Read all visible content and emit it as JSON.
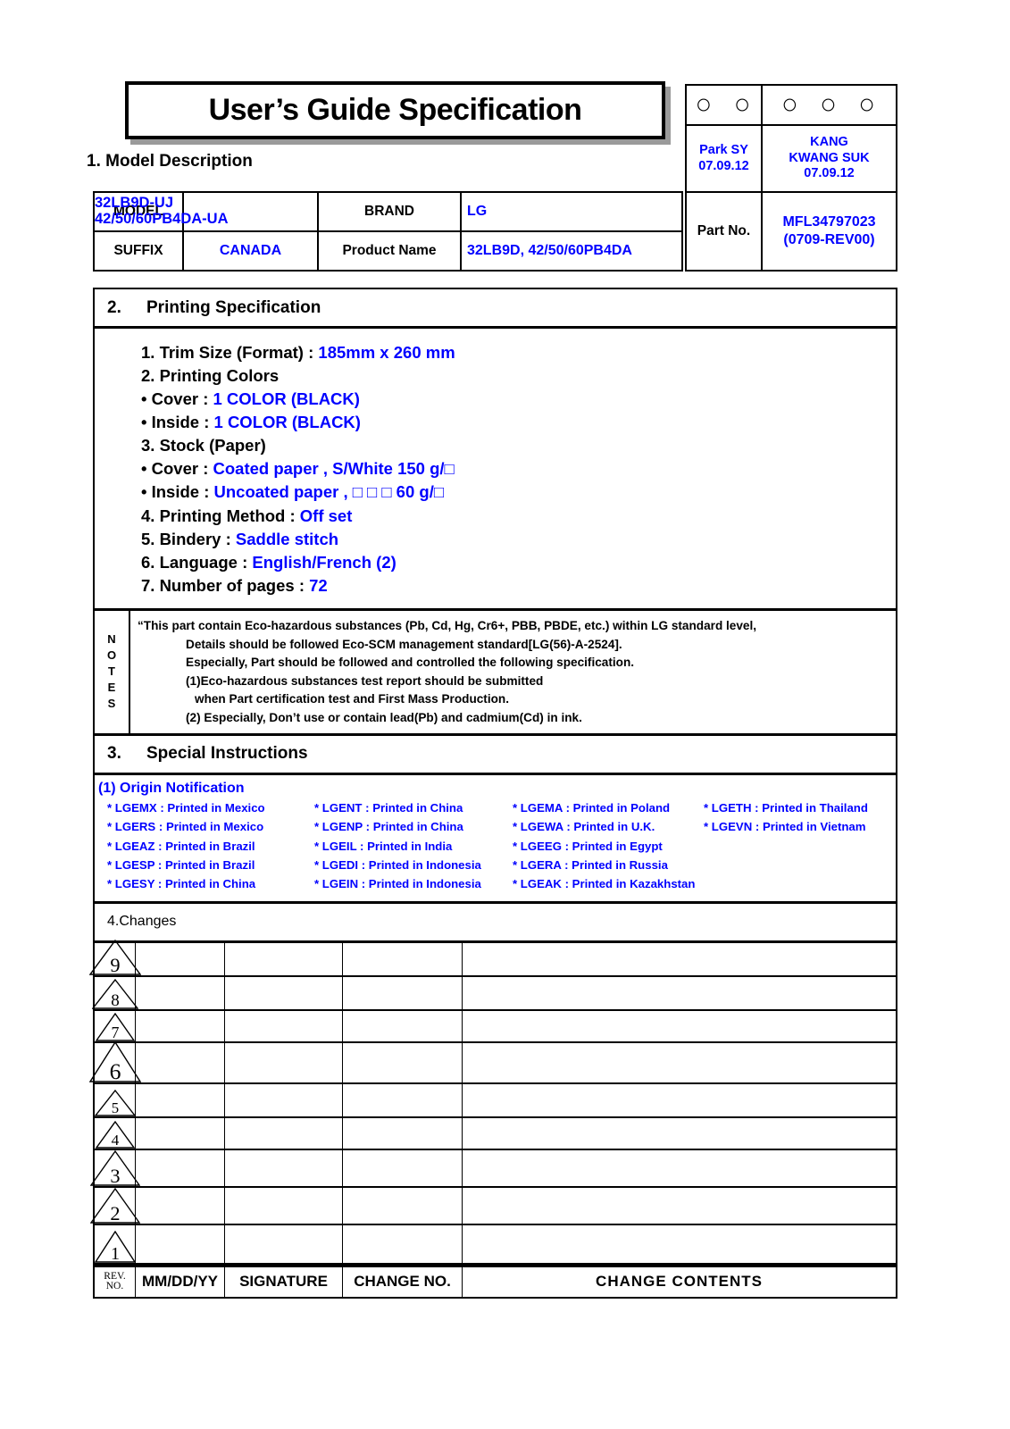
{
  "title": "User’s Guide Specification",
  "approval": {
    "header_cells": [
      "〇 〇",
      "〇 〇 〇"
    ],
    "approver1": "Park SY\n07.09.12",
    "approver2": "KANG\nKWANG SUK\n07.09.12"
  },
  "model_section": {
    "heading_number": "1.",
    "heading_text": "Model Description",
    "model_label": "MODEL",
    "model_value": "32LB9D-UJ\n42/50/60PB4DA-UA",
    "brand_label": "BRAND",
    "brand_value": "LG",
    "suffix_label": "SUFFIX",
    "suffix_value": "CANADA",
    "product_name_label": "Product Name",
    "product_name_value": "32LB9D, 42/50/60PB4DA",
    "part_no_label": "Part No.",
    "part_no_value": "MFL34797023\n(0709-REV00)"
  },
  "printing_section": {
    "heading_number": "2.",
    "heading_text": "Printing Specification",
    "lines": [
      {
        "label": "1. Trim Size (Format) : ",
        "value": "185mm x 260 mm"
      },
      {
        "label": "2. Printing Colors",
        "value": ""
      },
      {
        "label": "• Cover : ",
        "value": "1 COLOR (BLACK)"
      },
      {
        "label": "• Inside : ",
        "value": "1 COLOR (BLACK)"
      },
      {
        "label": "3. Stock (Paper)",
        "value": ""
      },
      {
        "label": "• Cover : ",
        "value": "Coated paper , S/White 150 g/□"
      },
      {
        "label": "• Inside : ",
        "value": "Uncoated paper , □ □ □  60 g/□"
      },
      {
        "label": "4. Printing Method : ",
        "value": "Off set"
      },
      {
        "label": "5. Bindery  : ",
        "value": "Saddle stitch"
      },
      {
        "label": "6. Language : ",
        "value": "English/French (2)"
      },
      {
        "label": "7. Number of pages : ",
        "value": "72"
      }
    ]
  },
  "notes": {
    "label_letters": [
      "N",
      "O",
      "T",
      "E",
      "S"
    ],
    "lines": [
      {
        "indent": 1,
        "text": "“This part contain Eco-hazardous substances (Pb, Cd, Hg, Cr6+, PBB, PBDE, etc.) within LG standard level,"
      },
      {
        "indent": 2,
        "text": "Details should be followed Eco-SCM management standard[LG(56)-A-2524]."
      },
      {
        "indent": 2,
        "text": "Especially, Part should be followed and controlled the following specification."
      },
      {
        "indent": 2,
        "text": "(1)Eco-hazardous substances test report should be submitted"
      },
      {
        "indent": 3,
        "text": "when  Part certification test and First Mass Production."
      },
      {
        "indent": 2,
        "text": "(2) Especially, Don’t use or contain lead(Pb) and cadmium(Cd) in ink."
      }
    ]
  },
  "special_section": {
    "heading_number": "3.",
    "heading_text": "Special Instructions",
    "origin_title": "(1) Origin Notification",
    "origin_entries": [
      "* LGEMX : Printed in Mexico",
      "* LGENT : Printed in China",
      "* LGEMA : Printed in Poland",
      "* LGETH : Printed in Thailand",
      "* LGERS : Printed in Mexico",
      "* LGENP : Printed in China",
      "* LGEWA : Printed in U.K.",
      "* LGEVN : Printed in Vietnam",
      "* LGEAZ : Printed in Brazil",
      "* LGEIL : Printed in India",
      "* LGEEG : Printed in Egypt",
      "",
      "* LGESP : Printed in Brazil",
      "* LGEDI : Printed in Indonesia",
      "* LGERA : Printed in Russia",
      "",
      "* LGESY : Printed in China",
      "* LGEIN : Printed in Indonesia",
      "* LGEAK : Printed in Kazakhstan",
      ""
    ]
  },
  "changes_section": {
    "heading_number": "4.",
    "heading_text": "Changes",
    "rows": [
      {
        "rev": "9",
        "date": "",
        "signature": "",
        "change_no": "",
        "contents": "",
        "tri_w": 58,
        "tri_h": 40
      },
      {
        "rev": "8",
        "date": "",
        "signature": "",
        "change_no": "",
        "contents": "",
        "tri_w": 52,
        "tri_h": 34
      },
      {
        "rev": "7",
        "date": "",
        "signature": "",
        "change_no": "",
        "contents": "",
        "tri_w": 44,
        "tri_h": 32
      },
      {
        "rev": "6",
        "date": "",
        "signature": "",
        "change_no": "",
        "contents": "",
        "tri_w": 58,
        "tri_h": 46
      },
      {
        "rev": "5",
        "date": "",
        "signature": "",
        "change_no": "",
        "contents": "",
        "tri_w": 46,
        "tri_h": 30
      },
      {
        "rev": "4",
        "date": "",
        "signature": "",
        "change_no": "",
        "contents": "",
        "tri_w": 44,
        "tri_h": 31
      },
      {
        "rev": "3",
        "date": "",
        "signature": "",
        "change_no": "",
        "contents": "",
        "tri_w": 56,
        "tri_h": 40
      },
      {
        "rev": "2",
        "date": "",
        "signature": "",
        "change_no": "",
        "contents": "",
        "tri_w": 56,
        "tri_h": 40
      },
      {
        "rev": "1",
        "date": "",
        "signature": "",
        "change_no": "",
        "contents": "",
        "tri_w": 46,
        "tri_h": 36
      }
    ],
    "footer": {
      "rev_no": "REV.\nNO.",
      "date": "MM/DD/YY",
      "signature": "SIGNATURE",
      "change_no": "CHANGE NO.",
      "contents": "CHANGE   CONTENTS"
    }
  },
  "colors": {
    "accent_blue": "#0000ff",
    "ink_black": "#000000",
    "shadow_gray": "#9a9a9a",
    "page_background": "#ffffff"
  }
}
